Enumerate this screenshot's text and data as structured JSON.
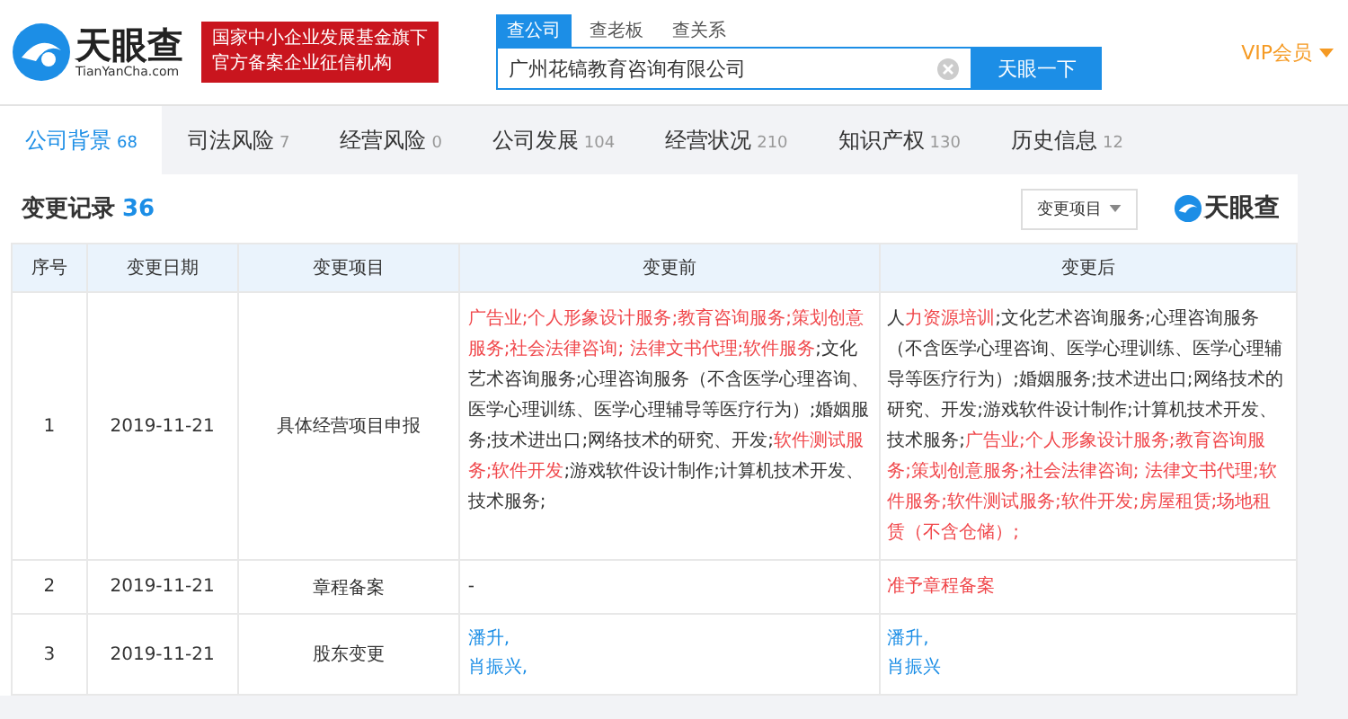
{
  "header": {
    "logo_text": "天眼查",
    "logo_domain": "TianYanCha.com",
    "banner_lines": [
      "国家中小企业发展基金旗下",
      "官方备案企业征信机构"
    ],
    "search_tabs": [
      {
        "label": "查公司",
        "selected": true
      },
      {
        "label": "查老板",
        "selected": false
      },
      {
        "label": "查关系",
        "selected": false
      }
    ],
    "search": {
      "value": "广州花镐教育咨询有限公司"
    },
    "search_button": "天眼一下",
    "vip": "VIP会员"
  },
  "nav_tabs": [
    {
      "label": "公司背景",
      "count": "68",
      "selected": true
    },
    {
      "label": "司法风险",
      "count": "7",
      "selected": false
    },
    {
      "label": "经营风险",
      "count": "0",
      "selected": false
    },
    {
      "label": "公司发展",
      "count": "104",
      "selected": false
    },
    {
      "label": "经营状况",
      "count": "210",
      "selected": false
    },
    {
      "label": "知识产权",
      "count": "130",
      "selected": false
    },
    {
      "label": "历史信息",
      "count": "12",
      "selected": false
    }
  ],
  "section": {
    "title": "变更记录",
    "count": "36",
    "filter": "变更项目",
    "watermark_logo": "天眼查"
  },
  "table": {
    "columns": [
      "序号",
      "变更日期",
      "变更项目",
      "变更前",
      "变更后"
    ],
    "rows": [
      {
        "index": "1",
        "date": "2019-11-21",
        "item": "具体经营项目申报",
        "before": [
          {
            "text": "广告业;个人形象设计服务;教育咨询服务;策划创意服务;社会法律咨询; 法律文书代理;软件服务",
            "changed": true
          },
          {
            "text": ";文化艺术咨询服务;心理咨询服务（不含医学心理咨询、医学心理训练、医学心理辅导等医疗行为）;婚姻服务;技术进出口;网络技术的研究、开发;",
            "changed": false
          },
          {
            "text": "软件测试服务;软件开发",
            "changed": true
          },
          {
            "text": ";游戏软件设计制作;计算机技术开发、技术服务;",
            "changed": false
          }
        ],
        "after": [
          {
            "text": "人",
            "changed": false
          },
          {
            "text": "力资源培训",
            "changed": true
          },
          {
            "text": ";文化艺术咨询服务;心理咨询服务（不含医学心理咨询、医学心理训练、医学心理辅导等医疗行为）;婚姻服务;技术进出口;网络技术的研究、开发;游戏软件设计制作;计算机技术开发、技术服务;",
            "changed": false
          },
          {
            "text": "广告业;个人形象设计服务;教育咨询服务;策划创意服务;社会法律咨询; 法律文书代理;软件服务;软件测试服务;软件开发;房屋租赁;场地租赁（不含仓储）;",
            "changed": true
          }
        ]
      },
      {
        "index": "2",
        "date": "2019-11-21",
        "item": "章程备案",
        "before": [
          {
            "text": "-",
            "changed": false
          }
        ],
        "after": [
          {
            "text": "准予章程备案",
            "changed": true
          }
        ]
      },
      {
        "index": "3",
        "date": "2019-11-21",
        "item": "股东变更",
        "before_links": [
          "潘升,",
          "肖振兴,"
        ],
        "after_links": [
          "潘升,",
          "肖振兴"
        ]
      }
    ]
  }
}
